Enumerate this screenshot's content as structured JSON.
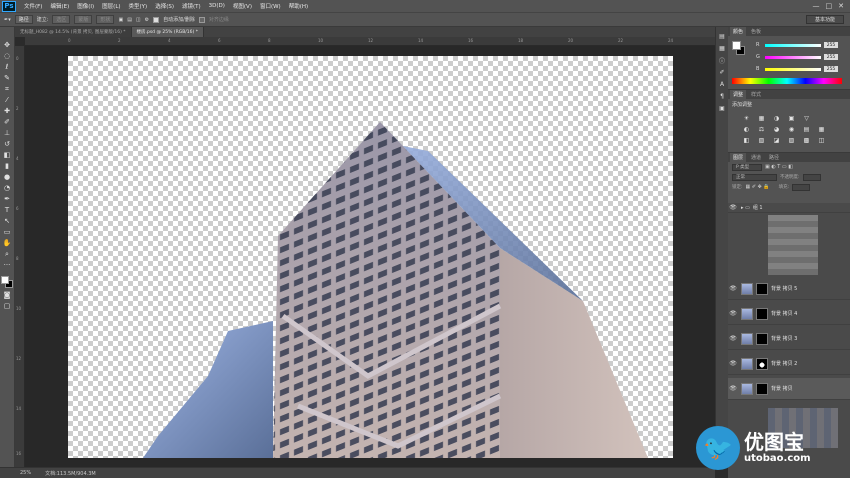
{
  "app": {
    "logo": "Ps"
  },
  "menu": [
    "文件(F)",
    "编辑(E)",
    "图像(I)",
    "图层(L)",
    "类型(Y)",
    "选择(S)",
    "滤镜(T)",
    "3D(D)",
    "视图(V)",
    "窗口(W)",
    "帮助(H)"
  ],
  "window_controls": [
    "—",
    "□",
    "✕"
  ],
  "options": {
    "mode": "路径",
    "make_label": "建立:",
    "selection": "选区",
    "mask": "蒙版",
    "shape": "形状",
    "auto_add_delete": "自动添加/删除",
    "align_edges": "对齐边缘",
    "workspace": "基本功能"
  },
  "tabs": [
    {
      "label": "无标题_H082 @ 14.5% (背景 拷贝, 图层蒙版/16) *",
      "active": false
    },
    {
      "label": "楼房.psd @ 25% (RGB/16) *",
      "active": true
    }
  ],
  "rulers": {
    "h": [
      "0",
      "2",
      "4",
      "6",
      "8",
      "10",
      "12",
      "14",
      "16",
      "18",
      "20",
      "22",
      "24"
    ],
    "v": [
      "0",
      "2",
      "4",
      "6",
      "8",
      "10",
      "12",
      "14",
      "16"
    ]
  },
  "status": {
    "zoom": "25%",
    "doc": "文档:113.5M/904.3M"
  },
  "panels": {
    "color_tabs": [
      "颜色",
      "色板"
    ],
    "channels": [
      {
        "name": "R",
        "value": "255",
        "color": "#ff3030"
      },
      {
        "name": "G",
        "value": "255",
        "color": "#30ff30"
      },
      {
        "name": "B",
        "value": "255",
        "color": "#3060ff"
      }
    ],
    "adj_tabs": [
      "调整",
      "样式"
    ],
    "adj_title": "添加调整",
    "adj_icons": [
      "☀",
      "▦",
      "◑",
      "▣",
      "▽",
      "",
      "◐",
      "⚖",
      "◕",
      "◉",
      "▤",
      "▦",
      "◧",
      "▧",
      "◪",
      "▨",
      "▩",
      "◫"
    ],
    "layers_tabs": [
      "图层",
      "通道",
      "路径"
    ],
    "kind": "P 类型",
    "blend": "正常",
    "opacity_label": "不透明度:",
    "lock_label": "锁定:",
    "fill_label": "填充:",
    "group": "组 1",
    "layers": [
      "背景 拷贝 5",
      "背景 拷贝 4",
      "背景 拷贝 3",
      "背景 拷贝 2",
      "背景 拷贝"
    ]
  },
  "watermark": {
    "cn": "优图宝",
    "url": "utobao.com"
  }
}
